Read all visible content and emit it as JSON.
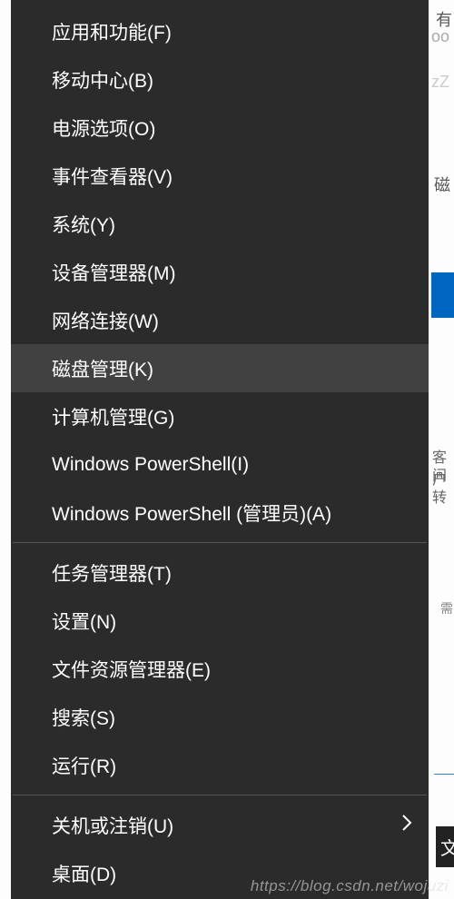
{
  "menu": {
    "items": [
      {
        "label": "应用和功能(F)",
        "highlighted": false,
        "hasSubmenu": false
      },
      {
        "label": "移动中心(B)",
        "highlighted": false,
        "hasSubmenu": false
      },
      {
        "label": "电源选项(O)",
        "highlighted": false,
        "hasSubmenu": false
      },
      {
        "label": "事件查看器(V)",
        "highlighted": false,
        "hasSubmenu": false
      },
      {
        "label": "系统(Y)",
        "highlighted": false,
        "hasSubmenu": false
      },
      {
        "label": "设备管理器(M)",
        "highlighted": false,
        "hasSubmenu": false
      },
      {
        "label": "网络连接(W)",
        "highlighted": false,
        "hasSubmenu": false
      },
      {
        "label": "磁盘管理(K)",
        "highlighted": true,
        "hasSubmenu": false
      },
      {
        "label": "计算机管理(G)",
        "highlighted": false,
        "hasSubmenu": false
      },
      {
        "label": "Windows PowerShell(I)",
        "highlighted": false,
        "hasSubmenu": false
      },
      {
        "label": "Windows PowerShell (管理员)(A)",
        "highlighted": false,
        "hasSubmenu": false
      },
      {
        "separator": true
      },
      {
        "label": "任务管理器(T)",
        "highlighted": false,
        "hasSubmenu": false
      },
      {
        "label": "设置(N)",
        "highlighted": false,
        "hasSubmenu": false
      },
      {
        "label": "文件资源管理器(E)",
        "highlighted": false,
        "hasSubmenu": false
      },
      {
        "label": "搜索(S)",
        "highlighted": false,
        "hasSubmenu": false
      },
      {
        "label": "运行(R)",
        "highlighted": false,
        "hasSubmenu": false
      },
      {
        "separator": true
      },
      {
        "label": "关机或注销(U)",
        "highlighted": false,
        "hasSubmenu": true
      },
      {
        "label": "桌面(D)",
        "highlighted": false,
        "hasSubmenu": false
      }
    ]
  },
  "backdrop": {
    "t1": "有",
    "t2": "oo",
    "t3": "zZ",
    "t4": "磁",
    "t5": "客户",
    "t6": "间转",
    "t7": "需",
    "tab": "文"
  },
  "watermark": "https://blog.csdn.net/wojuzi"
}
